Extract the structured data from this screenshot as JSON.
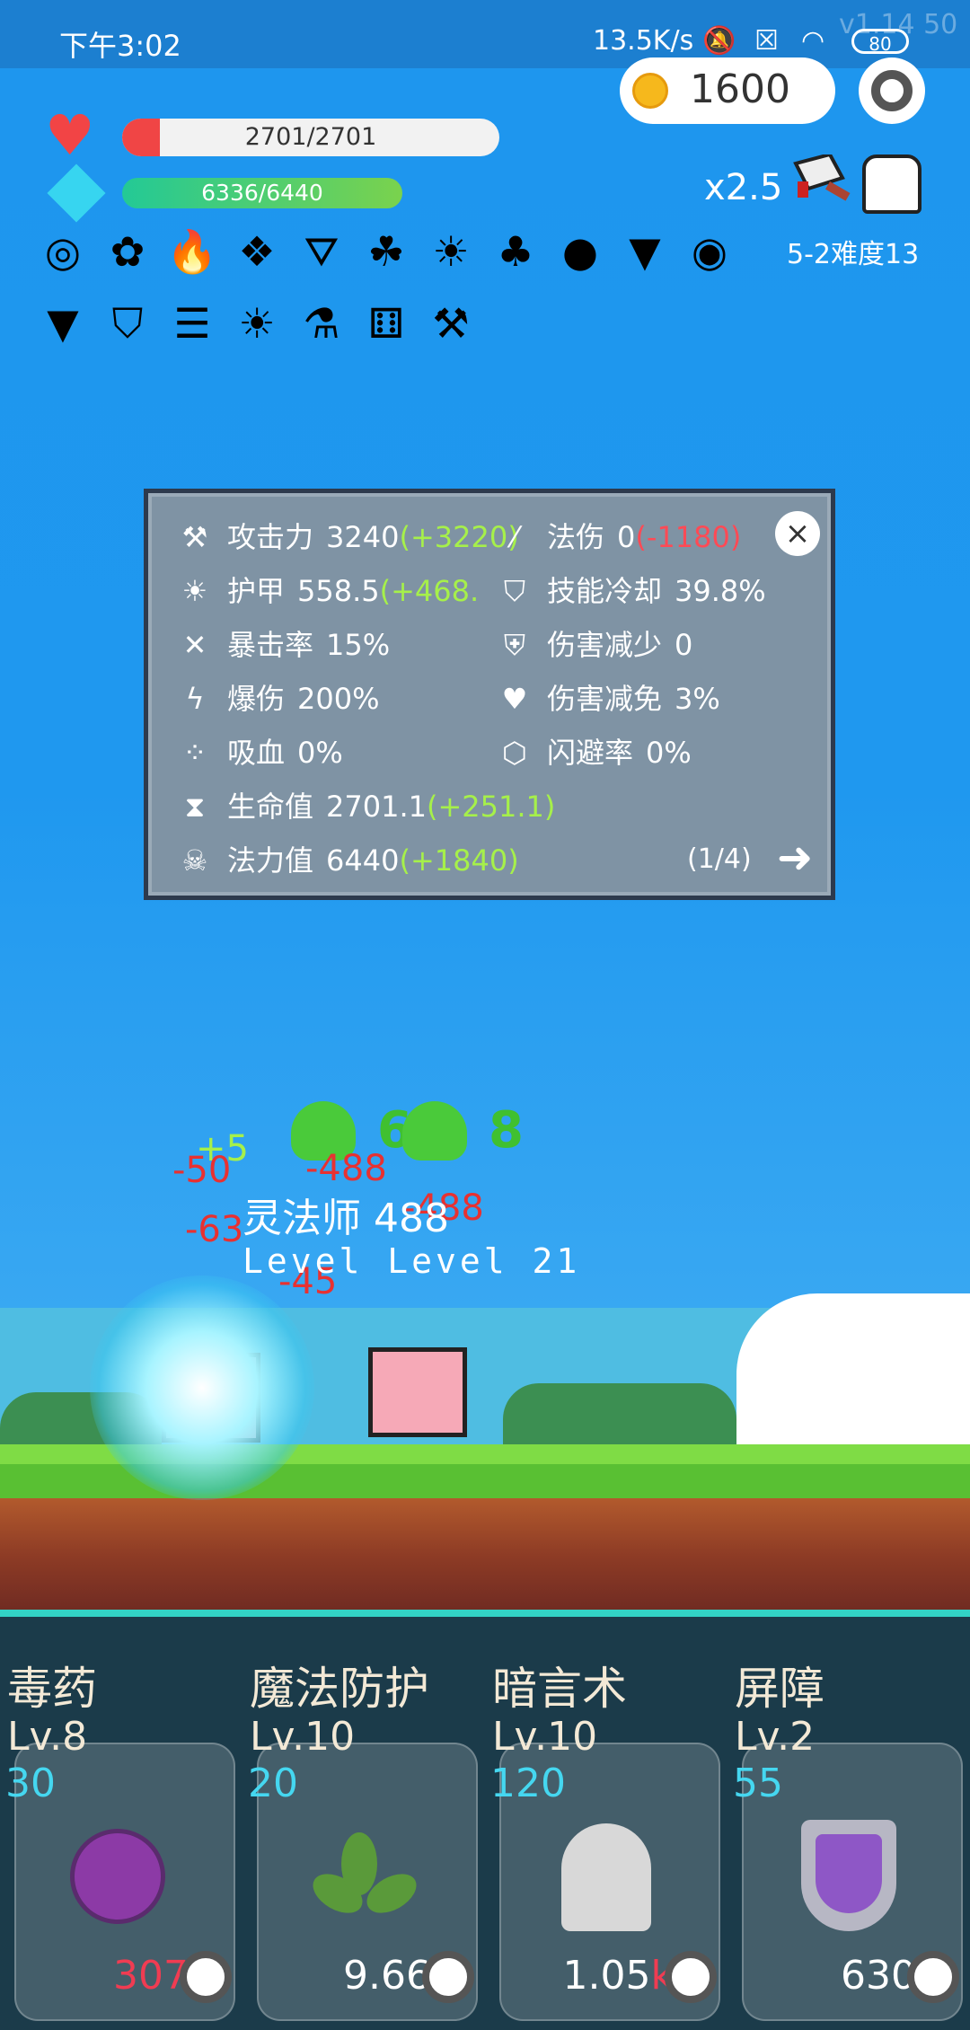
{
  "status_bar": {
    "time": "下午3:02",
    "net_speed": "13.5K/s",
    "battery": "80",
    "version": "v1.14 50"
  },
  "hud": {
    "coins": "1600",
    "hp_text": "2701/2701",
    "hp_fraction": 0.1,
    "mp_text": "6336/6440",
    "speed": "x2.5",
    "stage": "5-2难度13",
    "buff_icons": [
      "target-icon",
      "flower-icon",
      "fire-icon",
      "ice-cubes-icon",
      "wizard-hat-icon",
      "sprout-icon",
      "sun-icon",
      "tree-icon",
      "mushroom-icon",
      "ice-cream-icon",
      "crystal-ball-icon",
      "ice-cream-icon",
      "shield-icon",
      "speed-lines-icon",
      "sun-icon",
      "potion-icon",
      "dice-icon",
      "axe-icon"
    ]
  },
  "stats_panel": {
    "left": [
      {
        "icon": "axe-icon",
        "label": "攻击力",
        "value": "3240",
        "bonus": "(+3220)",
        "bonus_color": "green"
      },
      {
        "icon": "sun-icon",
        "label": "护甲",
        "value": "558.5",
        "bonus": "(+468.",
        "bonus_color": "green"
      },
      {
        "icon": "crossed-swords-icon",
        "label": "暴击率",
        "value": "15%",
        "bonus": "",
        "bonus_color": ""
      },
      {
        "icon": "lightning-icon",
        "label": "爆伤",
        "value": "200%",
        "bonus": "",
        "bonus_color": ""
      },
      {
        "icon": "circle-dots-icon",
        "label": "吸血",
        "value": "0%",
        "bonus": "",
        "bonus_color": ""
      },
      {
        "icon": "hourglass-icon",
        "label": "生命值",
        "value": "2701.1",
        "bonus": "(+251.1)",
        "bonus_color": "green"
      },
      {
        "icon": "demon-skull-icon",
        "label": "法力值",
        "value": "6440",
        "bonus": "(+1840)",
        "bonus_color": "green"
      }
    ],
    "right": [
      {
        "icon": "wand-icon",
        "label": "法伤",
        "value": "0",
        "bonus": "(-1180)",
        "bonus_color": "red"
      },
      {
        "icon": "shield-heart-icon",
        "label": "技能冷却",
        "value": "39.8%",
        "bonus": "",
        "bonus_color": ""
      },
      {
        "icon": "shield-icon",
        "label": "伤害减少",
        "value": "0",
        "bonus": "",
        "bonus_color": ""
      },
      {
        "icon": "heart-icon",
        "label": "伤害减免",
        "value": "3%",
        "bonus": "",
        "bonus_color": ""
      },
      {
        "icon": "hexagon-icon",
        "label": "闪避率",
        "value": "0%",
        "bonus": "",
        "bonus_color": ""
      }
    ],
    "close": "×",
    "page": "(1/4)",
    "next": "➜"
  },
  "battle": {
    "poison_counts": [
      "6",
      "8"
    ],
    "damage_numbers": [
      "+5",
      "-50",
      "-488",
      "-63",
      "-488",
      "-45"
    ],
    "monster_name": "灵法师  488",
    "monster_level": "Level Level 21"
  },
  "skills": [
    {
      "name": "毒药",
      "level": "Lv.8",
      "cost": "30",
      "price": "307",
      "price_unit": "",
      "icon": "poison-potion-icon"
    },
    {
      "name": "魔法防护",
      "level": "Lv.10",
      "cost": "20",
      "price": "9.66",
      "price_unit": "",
      "icon": "leaf-icon"
    },
    {
      "name": "暗言术",
      "level": "Lv.10",
      "cost": "120",
      "price": "1.05",
      "price_unit": "k",
      "icon": "ghost-icon"
    },
    {
      "name": "屏障",
      "level": "Lv.2",
      "cost": "55",
      "price": "630",
      "price_unit": "",
      "icon": "star-shield-icon"
    }
  ],
  "colors": {
    "sky": "#1f97ef",
    "hp": "#f04545",
    "mp": "#23c996",
    "panel": "#7f93a4",
    "bonus_green": "#a6f04a",
    "bonus_red": "#ff4a55",
    "cost_cyan": "#45d7f0",
    "skill_bg": "#1b3b4a"
  }
}
